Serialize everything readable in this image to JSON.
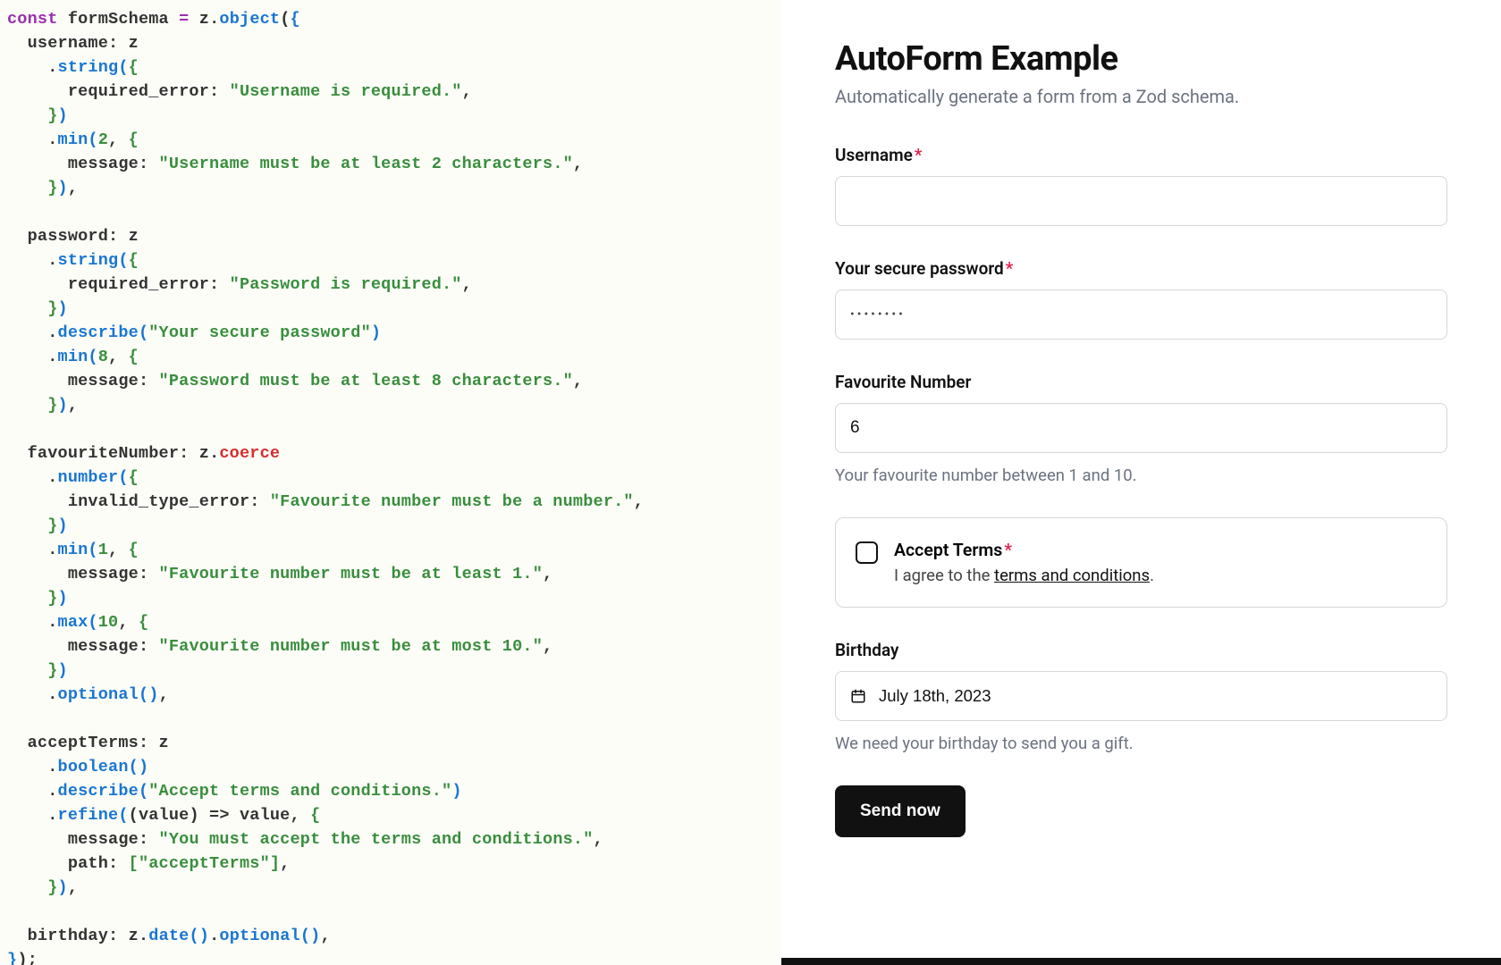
{
  "code": {
    "schemaVar": "formSchema",
    "z": "z",
    "object": "object",
    "fields": {
      "username": {
        "key": "username",
        "string": "string",
        "required_error_key": "required_error",
        "required_error_val": "\"Username is required.\"",
        "min_fn": "min",
        "min_n": "2",
        "min_msg_key": "message",
        "min_msg_val": "\"Username must be at least 2 characters.\""
      },
      "password": {
        "key": "password",
        "string": "string",
        "required_error_key": "required_error",
        "required_error_val": "\"Password is required.\"",
        "describe": "describe",
        "describe_val": "\"Your secure password\"",
        "min_fn": "min",
        "min_n": "8",
        "min_msg_key": "message",
        "min_msg_val": "\"Password must be at least 8 characters.\""
      },
      "favouriteNumber": {
        "key": "favouriteNumber",
        "coerce": "coerce",
        "number": "number",
        "invalid_key": "invalid_type_error",
        "invalid_val": "\"Favourite number must be a number.\"",
        "min_fn": "min",
        "min_n": "1",
        "min_msg_key": "message",
        "min_msg_val": "\"Favourite number must be at least 1.\"",
        "max_fn": "max",
        "max_n": "10",
        "max_msg_key": "message",
        "max_msg_val": "\"Favourite number must be at most 10.\"",
        "optional": "optional"
      },
      "acceptTerms": {
        "key": "acceptTerms",
        "boolean": "boolean",
        "describe": "describe",
        "describe_val": "\"Accept terms and conditions.\"",
        "refine": "refine",
        "refine_arg": "(value) => value",
        "refine_msg_key": "message",
        "refine_msg_val": "\"You must accept the terms and conditions.\"",
        "refine_path_key": "path",
        "refine_path_val": "[\"acceptTerms\"]"
      },
      "birthday": {
        "key": "birthday",
        "date": "date",
        "optional": "optional"
      }
    }
  },
  "form": {
    "title": "AutoForm Example",
    "subtitle": "Automatically generate a form from a Zod schema.",
    "username": {
      "label": "Username",
      "value": ""
    },
    "password": {
      "label": "Your secure password",
      "mask": "••••••••"
    },
    "favnum": {
      "label": "Favourite Number",
      "value": "6",
      "helper": "Your favourite number between 1 and 10."
    },
    "terms": {
      "label": "Accept Terms",
      "desc_prefix": "I agree to the ",
      "desc_link": "terms and conditions",
      "desc_suffix": "."
    },
    "birthday": {
      "label": "Birthday",
      "value": "July 18th, 2023",
      "helper": "We need your birthday to send you a gift."
    },
    "submit": {
      "label": "Send now"
    }
  }
}
